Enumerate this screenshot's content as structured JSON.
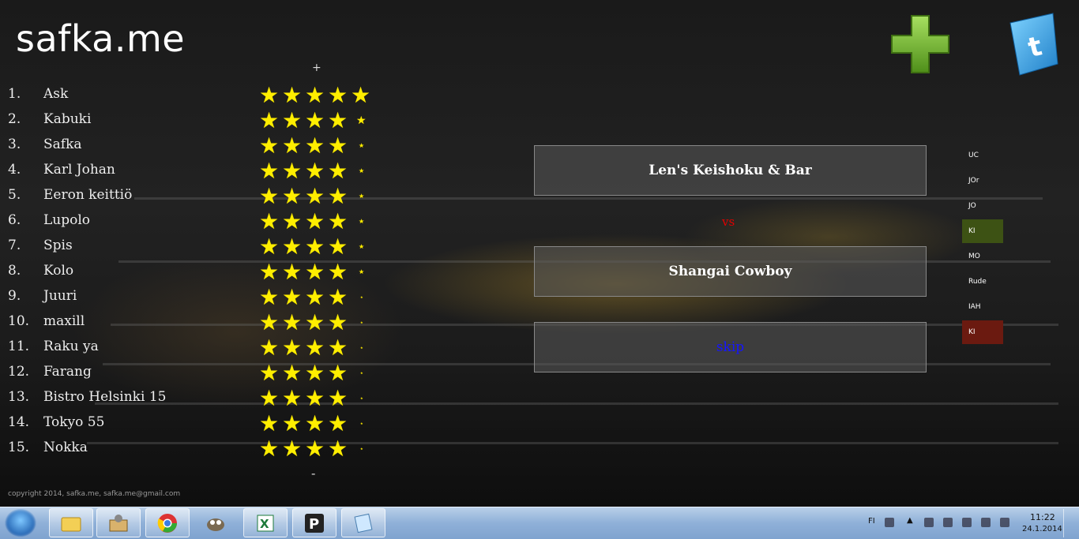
{
  "site": {
    "title": "safka.me"
  },
  "ranking": {
    "plus_label": "+",
    "minus_label": "-",
    "items": [
      {
        "rank": "1.",
        "name": "Ask",
        "rating": 5
      },
      {
        "rank": "2.",
        "name": "Kabuki",
        "rating": 4.5
      },
      {
        "rank": "3.",
        "name": "Safka",
        "rating": 4.3
      },
      {
        "rank": "4.",
        "name": "Karl Johan",
        "rating": 4.3
      },
      {
        "rank": "5.",
        "name": "Eeron keittiö",
        "rating": 4.3
      },
      {
        "rank": "6.",
        "name": "Lupolo",
        "rating": 4.3
      },
      {
        "rank": "7.",
        "name": "Spis",
        "rating": 4.3
      },
      {
        "rank": "8.",
        "name": "Kolo",
        "rating": 4.3
      },
      {
        "rank": "9.",
        "name": "Juuri",
        "rating": 4.05
      },
      {
        "rank": "10.",
        "name": "maxill",
        "rating": 4.05
      },
      {
        "rank": "11.",
        "name": "Raku ya",
        "rating": 4.05
      },
      {
        "rank": "12.",
        "name": "Farang",
        "rating": 4.05
      },
      {
        "rank": "13.",
        "name": "Bistro Helsinki 15",
        "rating": 4.05
      },
      {
        "rank": "14.",
        "name": "Tokyo 55",
        "rating": 4.05
      },
      {
        "rank": "15.",
        "name": "Nokka",
        "rating": 4.05
      }
    ]
  },
  "matchup": {
    "option_a": "Len's Keishoku & Bar",
    "vs_label": "vs",
    "option_b": "Shangai Cowboy",
    "skip_label": "skip",
    "vs_color": "#e00000",
    "skip_color": "#1515ff"
  },
  "side_panel": {
    "items": [
      {
        "label": "UC",
        "bg": ""
      },
      {
        "label": "JOr",
        "bg": ""
      },
      {
        "label": "JO",
        "bg": ""
      },
      {
        "label": "KI",
        "bg": "#3d5214"
      },
      {
        "label": "MO",
        "bg": ""
      },
      {
        "label": "Rude",
        "bg": ""
      },
      {
        "label": "IAH",
        "bg": ""
      },
      {
        "label": "KI",
        "bg": "#6b1a10"
      }
    ]
  },
  "actions": {
    "add_icon": "plus-icon",
    "twitter_icon": "twitter-icon"
  },
  "footer": {
    "copyright": "copyright 2014, safka.me, safka.me@gmail.com"
  },
  "taskbar": {
    "apps": [
      "windows-start",
      "file-explorer",
      "device-manager",
      "chrome",
      "gimp",
      "excel",
      "pearltrees",
      "notepad"
    ],
    "language": "FI",
    "time": "11:22",
    "date": "24.1.2014"
  },
  "colors": {
    "star": "#ffee00",
    "add_green": "#7fc234"
  }
}
